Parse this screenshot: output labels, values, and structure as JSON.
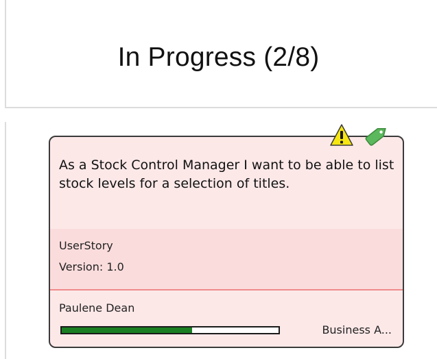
{
  "column": {
    "title": "In Progress (2/8)"
  },
  "card": {
    "story": "As a Stock Control Manager I want to be able to list stock levels for a selection of titles.",
    "type": "UserStory",
    "version": "Version: 1.0",
    "assignee": "Paulene Dean",
    "role": "Business A...",
    "progress_fraction": 0.6,
    "icons": [
      "warning-icon",
      "tag-icon"
    ]
  },
  "colors": {
    "card_background": "#fde8e8",
    "card_meta_background": "#fbdcdc",
    "divider": "#f08a8a",
    "progress_fill": "#1a7f23",
    "warning": "#f6e612",
    "tag": "#5cb85c"
  }
}
